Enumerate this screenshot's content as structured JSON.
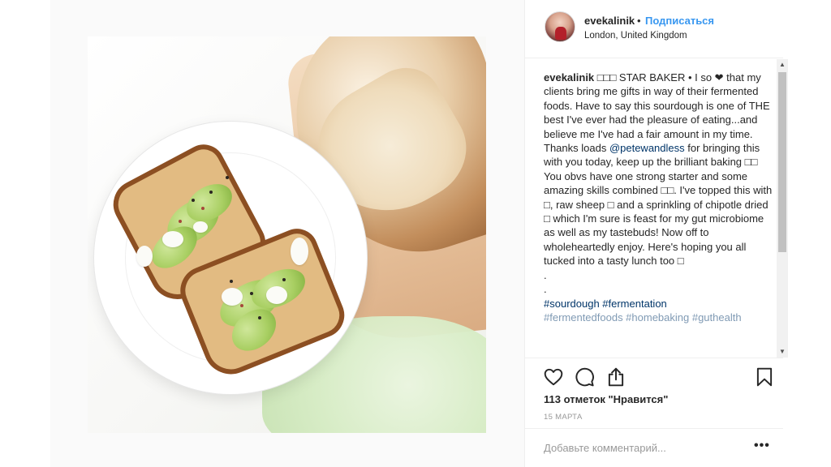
{
  "post": {
    "username": "evekalinik",
    "separator": "•",
    "follow_label": "Подписаться",
    "location": "London, United Kingdom"
  },
  "caption": {
    "username": "evekalinik",
    "part1": " □□□ STAR BAKER • I so ❤ that my clients bring me gifts in way of their fermented foods. Have to say this sourdough is one of THE best I've ever had the pleasure of eating...and believe me I've had a fair amount in my time. Thanks loads ",
    "mention": "@petewandless",
    "part2": " for bringing this with you today, keep up the brilliant baking □□ You obvs have one strong starter and some amazing skills combined □□. I've topped this with □, raw sheep □ and a sprinkling of chipotle dried □ which I'm sure is feast for my gut microbiome as well as my tastebuds! Now off to wholeheartedly enjoy. Here's hoping you all tucked into a tasty lunch too □",
    "dot1": ".",
    "dot2": ".",
    "hashtags": "#sourdough #fermentation",
    "cut_line": "#fermentedfoods #homebaking #guthealth"
  },
  "scrollbar": {
    "up_glyph": "▲",
    "down_glyph": "▼"
  },
  "actions": {
    "like_icon": "heart-icon",
    "comment_icon": "speech-bubble-icon",
    "share_icon": "share-icon",
    "save_icon": "bookmark-icon"
  },
  "likes_text": "113 отметок \"Нравится\"",
  "date_text": "15 марта",
  "comment": {
    "placeholder": "Добавьте комментарий...",
    "more_label": "•••"
  },
  "colors": {
    "link": "#3897f0",
    "mention": "#003569",
    "text": "#262626",
    "muted": "#999999"
  }
}
